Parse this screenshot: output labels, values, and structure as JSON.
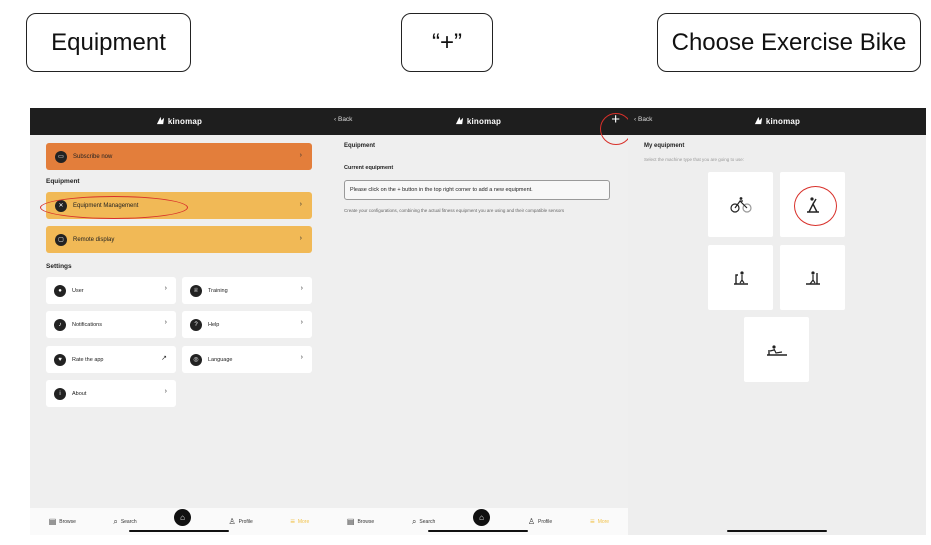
{
  "captions": {
    "step1": "Equipment",
    "step2": "“+”",
    "step3": "Choose Exercise Bike"
  },
  "app": {
    "logo_text": "kinomap"
  },
  "panel1": {
    "subscribe_label": "Subscribe now",
    "equipment_section": "Equipment",
    "equipment_mgmt_label": "Equipment Management",
    "remote_display_label": "Remote display",
    "settings_section": "Settings",
    "tiles": [
      {
        "label": "User",
        "icon": "user-icon",
        "glyph": "●"
      },
      {
        "label": "Training",
        "icon": "trophy-icon",
        "glyph": "♕"
      },
      {
        "label": "Notifications",
        "icon": "bell-icon",
        "glyph": "♪"
      },
      {
        "label": "Help",
        "icon": "help-icon",
        "glyph": "?"
      },
      {
        "label": "Rate the app",
        "icon": "heart-icon",
        "glyph": "♥"
      },
      {
        "label": "Language",
        "icon": "globe-icon",
        "glyph": "◎"
      },
      {
        "label": "About",
        "icon": "info-icon",
        "glyph": "i"
      }
    ]
  },
  "panel2": {
    "back_label": "Back",
    "plus_label": "+",
    "title": "Equipment",
    "current_label": "Current equipment",
    "input_text": "Please click on the + button in the top right corner to add a new equipment.",
    "help_text": "Create your configurations, combining the actual fitness equipment you are using and their compatible sensors"
  },
  "panel3": {
    "back_label": "Back",
    "title": "My equipment",
    "subtitle": "Select the machine type that you are going to use:"
  },
  "tabbar": {
    "browse": "Browse",
    "search": "Search",
    "profile": "Profile",
    "more": "More"
  },
  "colors": {
    "orange": "#e37e3b",
    "yellow": "#f1b956",
    "topbar": "#1e1e1e",
    "highlight": "#d8302a"
  }
}
